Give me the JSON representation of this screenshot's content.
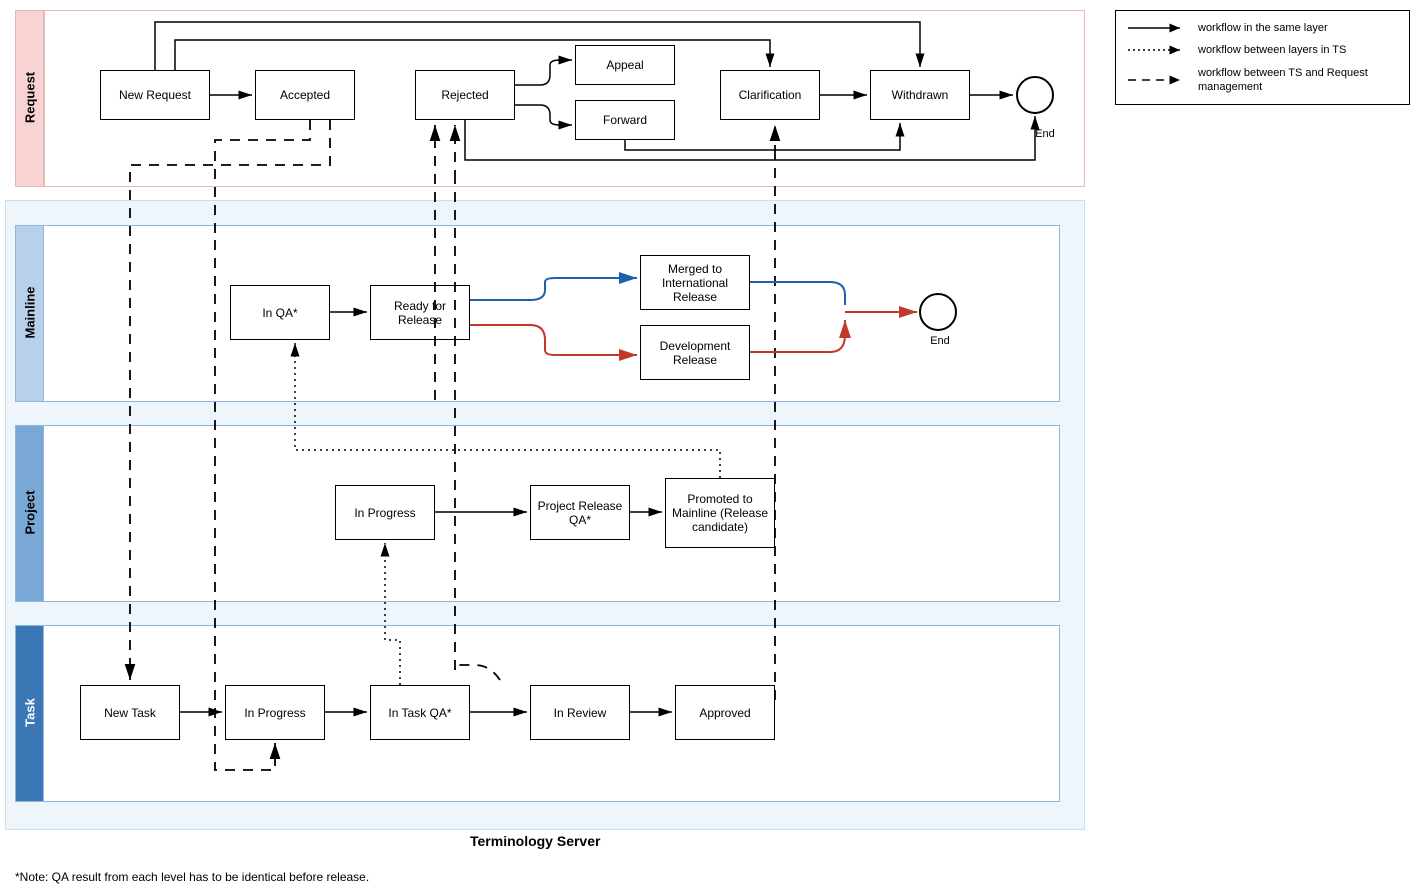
{
  "lanes": {
    "request": {
      "label": "Request"
    },
    "mainline": {
      "label": "Mainline"
    },
    "project": {
      "label": "Project"
    },
    "task": {
      "label": "Task"
    }
  },
  "tsTitle": "Terminology Server",
  "footnote": "*Note: QA result from each level has to be identical before release.",
  "legend": {
    "same": "workflow in the same layer",
    "betweenTS": "workflow between layers in TS",
    "betweenTSReq": "workflow between TS and Request management"
  },
  "nodes": {
    "newRequest": "New Request",
    "accepted": "Accepted",
    "rejected": "Rejected",
    "appeal": "Appeal",
    "forward": "Forward",
    "clarification": "Clarification",
    "withdrawn": "Withdrawn",
    "inQA": "In QA*",
    "readyRelease": "Ready for Release",
    "mergedIntl": "Merged to International Release",
    "devRelease": "Development Release",
    "projInProgress": "In Progress",
    "projReleaseQA": "Project Release QA*",
    "promoted": "Promoted to Mainline (Release candidate)",
    "newTask": "New Task",
    "taskInProgress": "In Progress",
    "inTaskQA": "In Task QA*",
    "inReview": "In Review",
    "approved": "Approved"
  },
  "endLabels": {
    "request": "End",
    "mainline": "End"
  },
  "colors": {
    "requestFill": "#f8d3d3",
    "requestBorder": "#e7b8b8",
    "mainlineFill": "#b8d1ea",
    "projectFill": "#7aa8d6",
    "taskFill": "#3b76b5",
    "laneBorder": "#8eb6de",
    "tsOuterFill": "#eef5fb",
    "tsOuterBorder": "#c8dff2",
    "blue": "#1e5fae",
    "red": "#c0392b"
  }
}
